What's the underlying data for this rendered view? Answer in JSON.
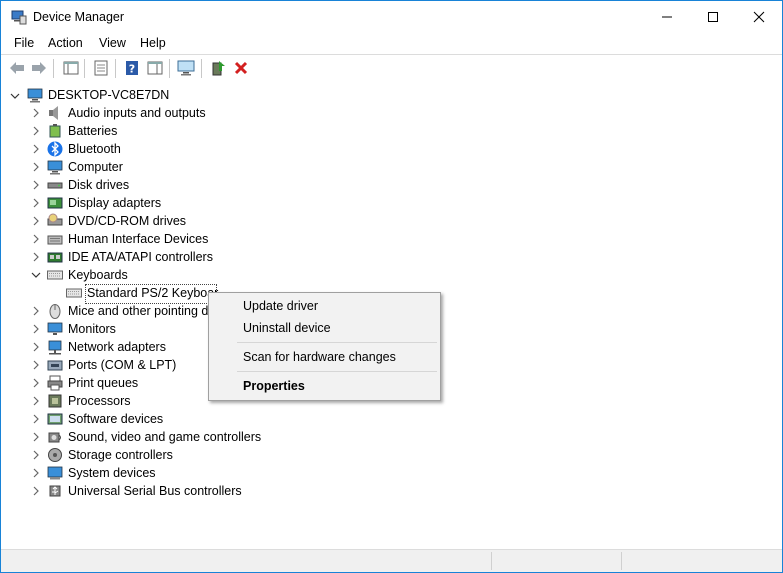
{
  "window": {
    "title": "Device Manager"
  },
  "menu": [
    "File",
    "Action",
    "View",
    "Help"
  ],
  "tree": {
    "root": "DESKTOP-VC8E7DN",
    "categories": [
      "Audio inputs and outputs",
      "Batteries",
      "Bluetooth",
      "Computer",
      "Disk drives",
      "Display adapters",
      "DVD/CD-ROM drives",
      "Human Interface Devices",
      "IDE ATA/ATAPI controllers",
      "Keyboards",
      "Mice and other pointing de",
      "Monitors",
      "Network adapters",
      "Ports (COM & LPT)",
      "Print queues",
      "Processors",
      "Software devices",
      "Sound, video and game controllers",
      "Storage controllers",
      "System devices",
      "Universal Serial Bus controllers"
    ],
    "keyboard_child": "Standard PS/2 Keyboar"
  },
  "context_menu": {
    "items": [
      "Update driver",
      "Uninstall device",
      "Scan for hardware changes",
      "Properties"
    ]
  },
  "colors": {
    "accent": "#1883d7",
    "remove_red": "#d32020",
    "help_blue": "#2b5aa8"
  }
}
